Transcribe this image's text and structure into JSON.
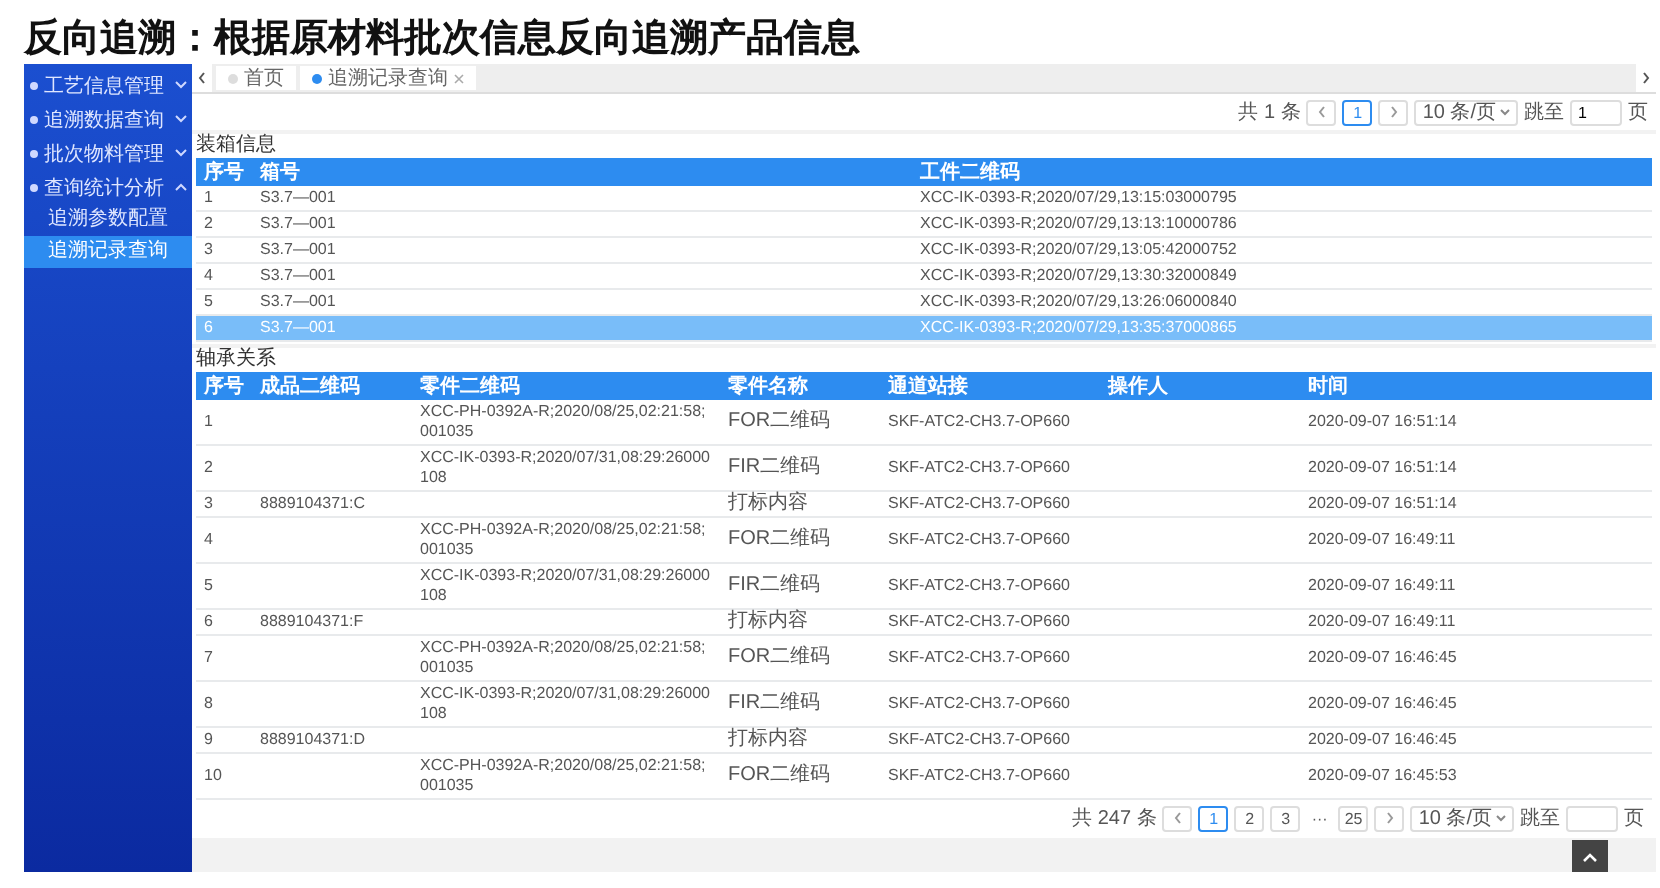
{
  "page_title": "反向追溯：根据原材料批次信息反向追溯产品信息",
  "sidebar": {
    "items": [
      {
        "label": "工艺信息管理",
        "expanded": false
      },
      {
        "label": "追溯数据查询",
        "expanded": false
      },
      {
        "label": "批次物料管理",
        "expanded": false
      },
      {
        "label": "查询统计分析",
        "expanded": true,
        "children": [
          {
            "label": "追溯参数配置",
            "selected": false
          },
          {
            "label": "追溯记录查询",
            "selected": true
          }
        ]
      }
    ]
  },
  "tabs": [
    {
      "label": "首页",
      "selected": false,
      "closable": false
    },
    {
      "label": "追溯记录查询",
      "selected": true,
      "closable": true
    }
  ],
  "top_pager": {
    "total": "共 1 条",
    "pages": [
      {
        "label": "1",
        "selected": true
      }
    ],
    "page_size": "10 条/页",
    "jump_label": "跳至",
    "jump_value": "1",
    "page_unit": "页"
  },
  "packing": {
    "title": "装箱信息",
    "columns": [
      "序号",
      "箱号",
      "工件二维码"
    ],
    "rows": [
      {
        "cells": [
          "1",
          "S3.7—001",
          "XCC-IK-0393-R;2020/07/29,13:15:03000795"
        ],
        "selected": false
      },
      {
        "cells": [
          "2",
          "S3.7—001",
          "XCC-IK-0393-R;2020/07/29,13:13:10000786"
        ],
        "selected": false
      },
      {
        "cells": [
          "3",
          "S3.7—001",
          "XCC-IK-0393-R;2020/07/29,13:05:42000752"
        ],
        "selected": false
      },
      {
        "cells": [
          "4",
          "S3.7—001",
          "XCC-IK-0393-R;2020/07/29,13:30:32000849"
        ],
        "selected": false
      },
      {
        "cells": [
          "5",
          "S3.7—001",
          "XCC-IK-0393-R;2020/07/29,13:26:06000840"
        ],
        "selected": false
      },
      {
        "cells": [
          "6",
          "S3.7—001",
          "XCC-IK-0393-R;2020/07/29,13:35:37000865"
        ],
        "selected": true
      }
    ]
  },
  "bearing": {
    "title": "轴承关系",
    "columns": [
      "序号",
      "成品二维码",
      "零件二维码",
      "零件名称",
      "通道站接",
      "操作人",
      "时间"
    ],
    "rows": [
      {
        "cells": [
          "1",
          "",
          "XCC-PH-0392A-R;2020/08/25,02:21:58;001035",
          "FOR二维码",
          "SKF-ATC2-CH3.7-OP660",
          "",
          "2020-09-07 16:51:14"
        ]
      },
      {
        "cells": [
          "2",
          "",
          "XCC-IK-0393-R;2020/07/31,08:29:26000108",
          "FIR二维码",
          "SKF-ATC2-CH3.7-OP660",
          "",
          "2020-09-07 16:51:14"
        ]
      },
      {
        "cells": [
          "3",
          "8889104371:C",
          "",
          "打标内容",
          "SKF-ATC2-CH3.7-OP660",
          "",
          "2020-09-07 16:51:14"
        ]
      },
      {
        "cells": [
          "4",
          "",
          "XCC-PH-0392A-R;2020/08/25,02:21:58;001035",
          "FOR二维码",
          "SKF-ATC2-CH3.7-OP660",
          "",
          "2020-09-07 16:49:11"
        ]
      },
      {
        "cells": [
          "5",
          "",
          "XCC-IK-0393-R;2020/07/31,08:29:26000108",
          "FIR二维码",
          "SKF-ATC2-CH3.7-OP660",
          "",
          "2020-09-07 16:49:11"
        ]
      },
      {
        "cells": [
          "6",
          "8889104371:F",
          "",
          "打标内容",
          "SKF-ATC2-CH3.7-OP660",
          "",
          "2020-09-07 16:49:11"
        ]
      },
      {
        "cells": [
          "7",
          "",
          "XCC-PH-0392A-R;2020/08/25,02:21:58;001035",
          "FOR二维码",
          "SKF-ATC2-CH3.7-OP660",
          "",
          "2020-09-07 16:46:45"
        ]
      },
      {
        "cells": [
          "8",
          "",
          "XCC-IK-0393-R;2020/07/31,08:29:26000108",
          "FIR二维码",
          "SKF-ATC2-CH3.7-OP660",
          "",
          "2020-09-07 16:46:45"
        ]
      },
      {
        "cells": [
          "9",
          "8889104371:D",
          "",
          "打标内容",
          "SKF-ATC2-CH3.7-OP660",
          "",
          "2020-09-07 16:46:45"
        ]
      },
      {
        "cells": [
          "10",
          "",
          "XCC-PH-0392A-R;2020/08/25,02:21:58;001035",
          "FOR二维码",
          "SKF-ATC2-CH3.7-OP660",
          "",
          "2020-09-07 16:45:53"
        ]
      }
    ]
  },
  "bottom_pager": {
    "total": "共 247 条",
    "pages": [
      {
        "label": "1",
        "selected": true
      },
      {
        "label": "2",
        "selected": false
      },
      {
        "label": "3",
        "selected": false
      },
      {
        "label": "···",
        "kind": "ellipsis"
      },
      {
        "label": "25",
        "selected": false
      }
    ],
    "page_size": "10 条/页",
    "jump_label": "跳至",
    "page_unit": "页"
  }
}
